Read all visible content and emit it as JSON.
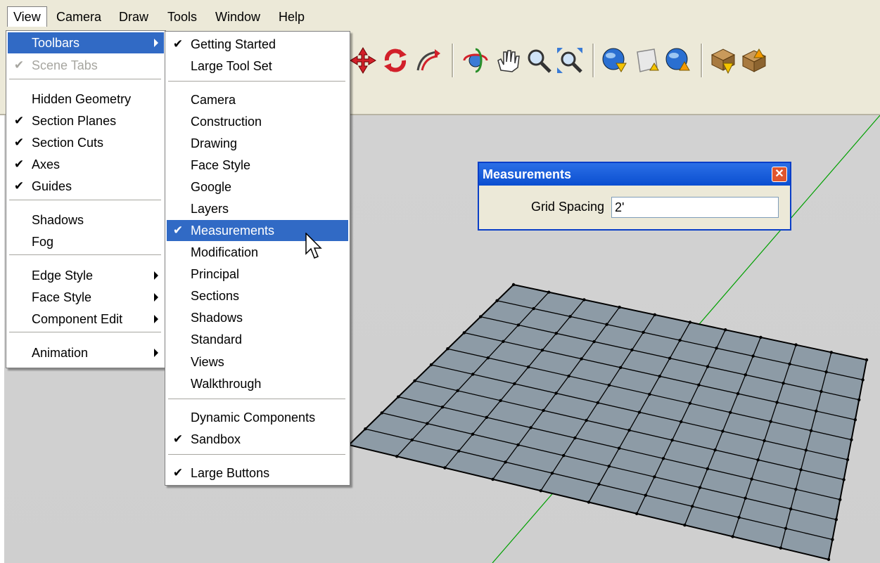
{
  "menubar": {
    "items": [
      {
        "label": "View",
        "open": true
      },
      {
        "label": "Camera"
      },
      {
        "label": "Draw"
      },
      {
        "label": "Tools"
      },
      {
        "label": "Window"
      },
      {
        "label": "Help"
      }
    ]
  },
  "view_menu": {
    "items": [
      {
        "label": "Toolbars",
        "submenu": true,
        "highlighted": true
      },
      {
        "label": "Scene Tabs",
        "checked": true,
        "disabled": true
      },
      {
        "label": "Hidden Geometry"
      },
      {
        "label": "Section Planes",
        "checked": true
      },
      {
        "label": "Section Cuts",
        "checked": true
      },
      {
        "label": "Axes",
        "checked": true
      },
      {
        "label": "Guides",
        "checked": true
      },
      {
        "label": "Shadows"
      },
      {
        "label": "Fog"
      },
      {
        "label": "Edge Style",
        "submenu": true
      },
      {
        "label": "Face Style",
        "submenu": true
      },
      {
        "label": "Component Edit",
        "submenu": true
      },
      {
        "label": "Animation",
        "submenu": true
      }
    ]
  },
  "toolbars_submenu": {
    "items": [
      {
        "label": "Getting Started",
        "checked": true
      },
      {
        "label": "Large Tool Set"
      },
      {
        "label": "Camera"
      },
      {
        "label": "Construction"
      },
      {
        "label": "Drawing"
      },
      {
        "label": "Face Style"
      },
      {
        "label": "Google"
      },
      {
        "label": "Layers"
      },
      {
        "label": "Measurements",
        "checked": true,
        "highlighted": true
      },
      {
        "label": "Modification"
      },
      {
        "label": "Principal"
      },
      {
        "label": "Sections"
      },
      {
        "label": "Shadows"
      },
      {
        "label": "Standard"
      },
      {
        "label": "Views"
      },
      {
        "label": "Walkthrough"
      },
      {
        "label": "Dynamic Components"
      },
      {
        "label": "Sandbox",
        "checked": true
      },
      {
        "label": "Large Buttons",
        "checked": true
      }
    ]
  },
  "measurements": {
    "title": "Measurements",
    "field_label": "Grid Spacing",
    "field_value": "2'"
  },
  "checkmark": "✔",
  "icons": [
    "move-icon",
    "rotate-icon",
    "follow-me-icon",
    "orbit-icon",
    "pan-icon",
    "zoom-icon",
    "zoom-extents-icon",
    "get-models-icon",
    "share-model-icon",
    "share-component-icon",
    "get-component-icon",
    "place-model-icon"
  ],
  "colors": {
    "highlight": "#316ac5",
    "axis_green": "#00a000",
    "grid_fill": "#8d9ba6",
    "titlebar": "#0a4ed0"
  }
}
